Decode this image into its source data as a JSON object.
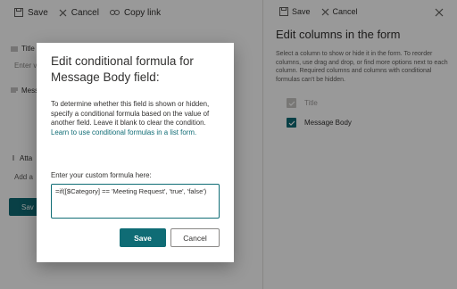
{
  "form_toolbar": {
    "save_label": "Save",
    "cancel_label": "Cancel",
    "copy_link_label": "Copy link"
  },
  "form_fields": {
    "title_label": "Title",
    "title_placeholder": "Enter v",
    "message_label": "Mess",
    "attachments_label": "Atta",
    "add_attachment_label": "Add a",
    "save_button_label": "Sav"
  },
  "panel": {
    "save_label": "Save",
    "cancel_label": "Cancel",
    "title": "Edit columns in the form",
    "description": "Select a column to show or hide it in the form. To reorder columns, use drag and drop, or find more options next to each column. Required columns and columns with conditional formulas can't be hidden.",
    "columns": [
      {
        "label": "Title",
        "state": "disabled"
      },
      {
        "label": "Message Body",
        "state": "checked"
      }
    ]
  },
  "dialog": {
    "title": "Edit conditional formula for Message Body field:",
    "description": "To determine whether this field is shown or hidden, specify a conditional formula based on the value of another field. Leave it blank to clear the condition.",
    "link_text": "Learn to use conditional formulas in a list form.",
    "input_label": "Enter your custom formula here:",
    "formula": "=if([$Category] == 'Meeting Request', 'true', 'false')",
    "save_label": "Save",
    "cancel_label": "Cancel"
  },
  "colors": {
    "accent": "#0f6c75",
    "overlay": "rgba(0,0,0,0.40)"
  }
}
